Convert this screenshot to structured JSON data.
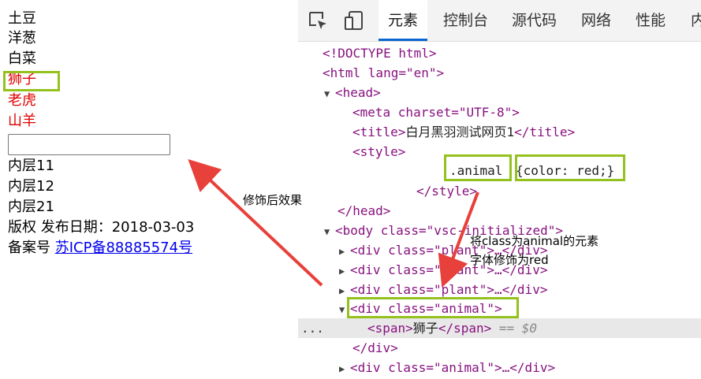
{
  "page": {
    "items": [
      "土豆",
      "洋葱",
      "白菜",
      "狮子",
      "老虎",
      "山羊"
    ],
    "inner": [
      "内层11",
      "内层12",
      "内层21"
    ],
    "copyright": "版权 发布日期：2018-03-03",
    "record_label": "备案号",
    "record_link": "苏ICP备88885574号"
  },
  "devtools": {
    "tabs": [
      "元素",
      "控制台",
      "源代码",
      "网络",
      "性能",
      "内"
    ],
    "active_tab": "元素",
    "icons": [
      "inspect-icon",
      "device-toggle-icon"
    ]
  },
  "tree": {
    "doctype": "<!DOCTYPE html>",
    "html_open": "<html lang=\"en\">",
    "head_open": "<head>",
    "meta": "<meta charset=\"UTF-8\">",
    "title_open": "<title>",
    "title_text": "白月黑羽测试网页1",
    "title_close": "</title>",
    "style_open": "<style>",
    "css_selector": ".animal",
    "css_rule": "{color: red;}",
    "style_close": "</style>",
    "head_close": "</head>",
    "body_open": "<body class=\"vsc-initialized\">",
    "div_plant_1": "<div class=\"plant\">…</div>",
    "div_plant_2": "<div class=\"plant\">…</div>",
    "div_plant_3": "<div class=\"plant\">…</div>",
    "div_animal_open": "<div class=\"animal\">",
    "span_open": "<span>",
    "span_text": "狮子",
    "span_close": "</span>",
    "span_marker": "== $0",
    "div_close": "</div>",
    "div_animal_2": "<div class=\"animal\">…</div>",
    "row_dots": "..."
  },
  "annotations": {
    "effect": "修饰后效果",
    "explain_line1": "将class为animal的元素",
    "explain_line2": "字体修饰为red"
  },
  "colors": {
    "highlight_border": "#95c11f",
    "arrow": "#e8403a",
    "red_text": "#e00000"
  }
}
